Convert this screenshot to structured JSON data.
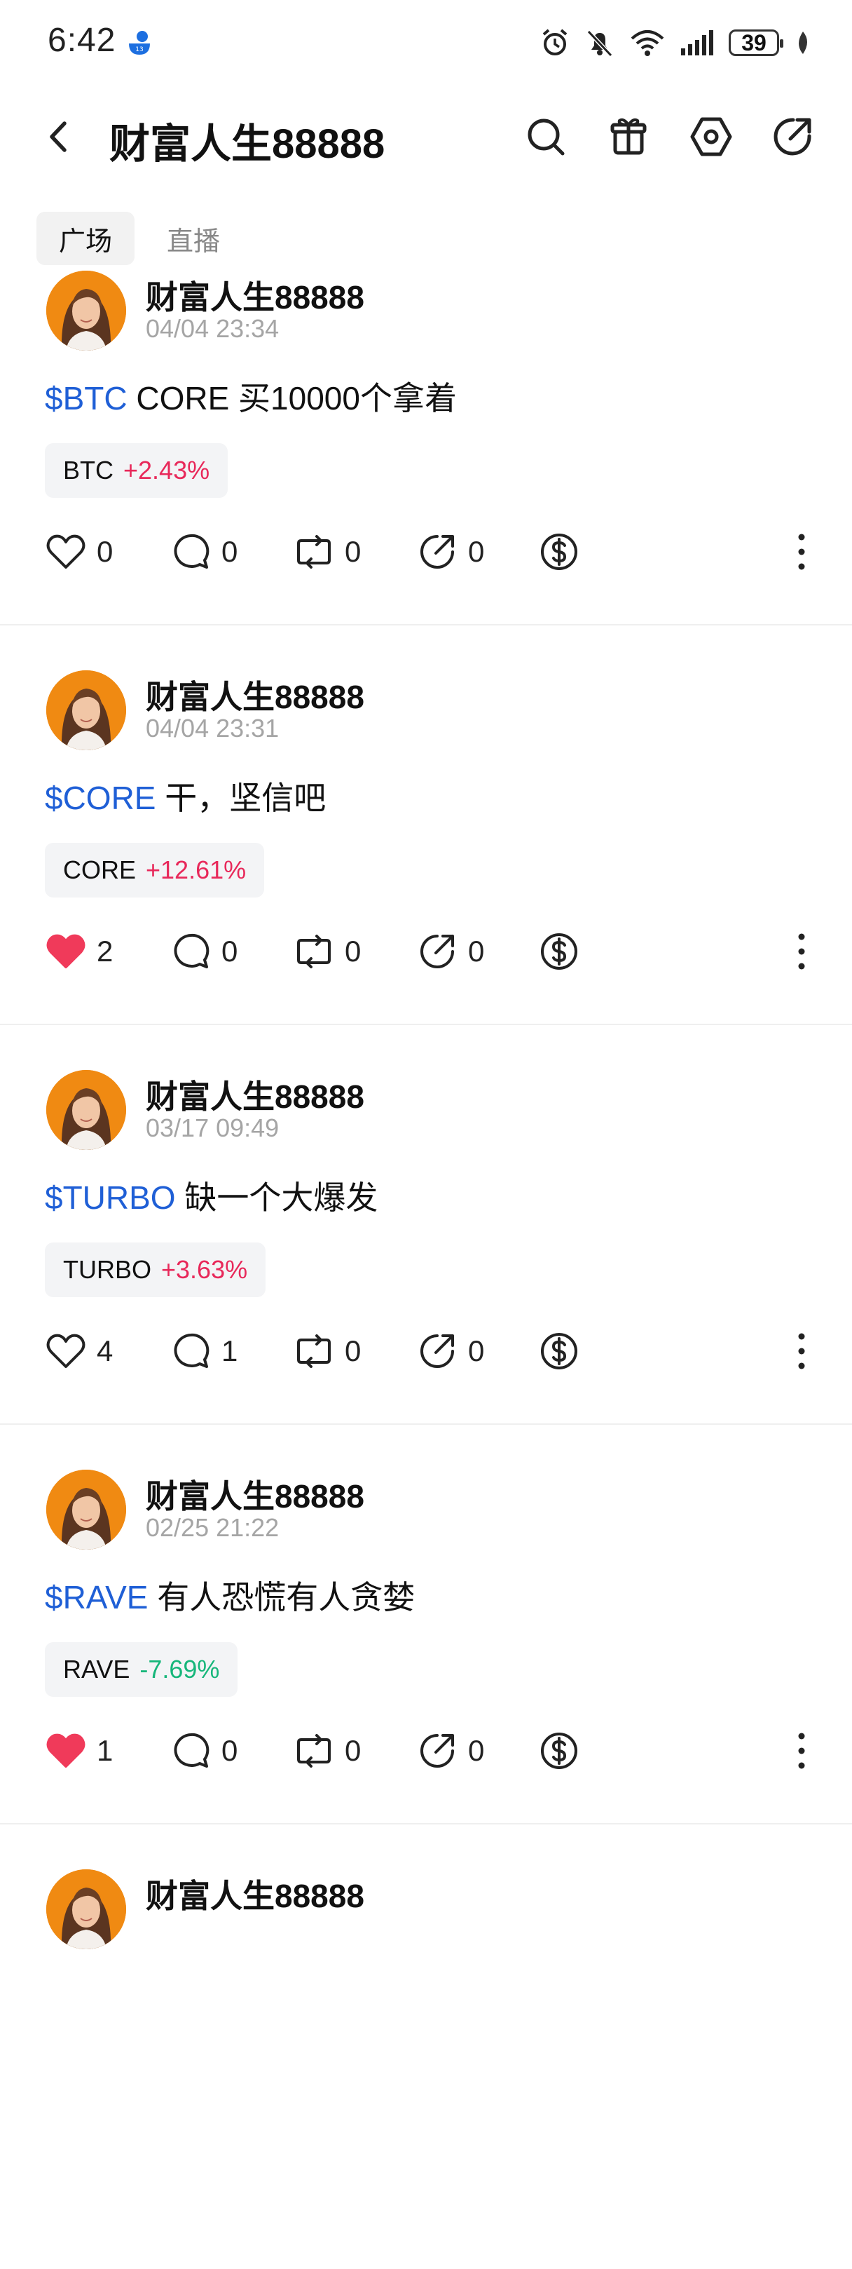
{
  "status_bar": {
    "time": "6:42",
    "battery": "39"
  },
  "header": {
    "title": "财富人生88888"
  },
  "tabs": [
    {
      "label": "广场",
      "active": true
    },
    {
      "label": "直播",
      "active": false
    }
  ],
  "posts": [
    {
      "author": "财富人生88888",
      "time": "04/04 23:34",
      "ticker": "$BTC",
      "text": " CORE 买10000个拿着",
      "tag_symbol": "BTC",
      "tag_change": "+2.43%",
      "tag_direction": "up",
      "likes": "0",
      "liked": false,
      "comments": "0",
      "reposts": "0",
      "shares": "0"
    },
    {
      "author": "财富人生88888",
      "time": "04/04 23:31",
      "ticker": "$CORE",
      "text": " 干，坚信吧",
      "tag_symbol": "CORE",
      "tag_change": "+12.61%",
      "tag_direction": "up",
      "likes": "2",
      "liked": true,
      "comments": "0",
      "reposts": "0",
      "shares": "0"
    },
    {
      "author": "财富人生88888",
      "time": "03/17 09:49",
      "ticker": "$TURBO",
      "text": " 缺一个大爆发",
      "tag_symbol": "TURBO",
      "tag_change": "+3.63%",
      "tag_direction": "up",
      "likes": "4",
      "liked": false,
      "comments": "1",
      "reposts": "0",
      "shares": "0"
    },
    {
      "author": "财富人生88888",
      "time": "02/25 21:22",
      "ticker": "$RAVE",
      "text": " 有人恐慌有人贪婪",
      "tag_symbol": "RAVE",
      "tag_change": "-7.69%",
      "tag_direction": "down",
      "likes": "1",
      "liked": true,
      "comments": "0",
      "reposts": "0",
      "shares": "0"
    },
    {
      "author": "财富人生88888"
    }
  ],
  "colors": {
    "link": "#1f5fd6",
    "up": "#e8285a",
    "down": "#16b67a",
    "like": "#f03a5a"
  },
  "icons": [
    "back-arrow-icon",
    "search-icon",
    "gift-icon",
    "settings-hexagon-icon",
    "share-icon",
    "heart-icon",
    "comment-icon",
    "repost-icon",
    "share-arrow-icon",
    "dollar-tip-icon",
    "more-vertical-icon"
  ]
}
